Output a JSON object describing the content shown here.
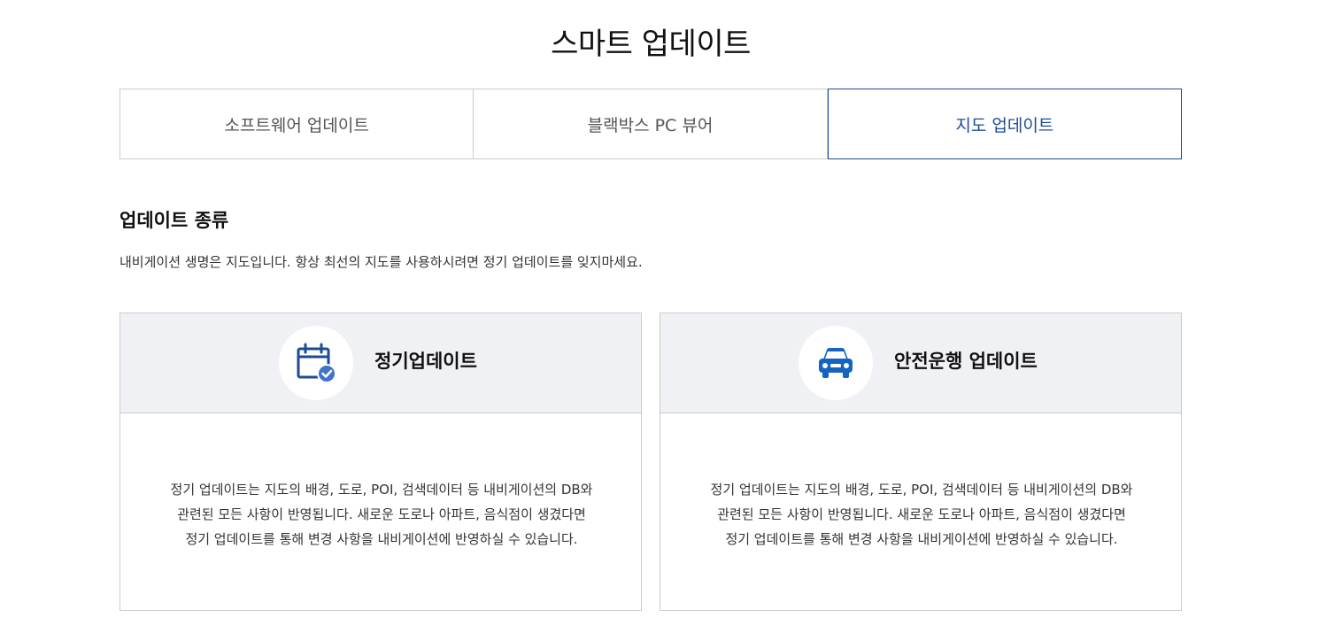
{
  "page": {
    "title": "스마트 업데이트"
  },
  "tabs": [
    {
      "label": "소프트웨어 업데이트",
      "active": false
    },
    {
      "label": "블랙박스 PC 뷰어",
      "active": false
    },
    {
      "label": "지도 업데이트",
      "active": true
    }
  ],
  "section": {
    "heading": "업데이트 종류",
    "description": "내비게이션 생명은 지도입니다. 항상 최선의 지도를 사용하시려면 정기 업데이트를 잊지마세요."
  },
  "cards": [
    {
      "title": "정기업데이트",
      "icon": "calendar-check-icon",
      "body": "정기 업데이트는 지도의 배경, 도로, POI, 검색데이터 등 내비게이션의 DB와 관련된 모든 사항이 반영됩니다. 새로운 도로나 아파트, 음식점이 생겼다면 정기 업데이트를 통해 변경 사항을 내비게이션에 반영하실 수 있습니다."
    },
    {
      "title": "안전운행 업데이트",
      "icon": "car-icon",
      "body": "정기 업데이트는 지도의 배경, 도로, POI, 검색데이터 등 내비게이션의 DB와 관련된 모든 사항이 반영됩니다. 새로운 도로나 아파트, 음식점이 생겼다면 정기 업데이트를 통해 변경 사항을 내비게이션에 반영하실 수 있습니다."
    }
  ],
  "colors": {
    "accent": "#1d4b94",
    "icon_blue": "#1565c0",
    "card_header_bg": "#f0f1f5",
    "border": "#cccccc"
  }
}
